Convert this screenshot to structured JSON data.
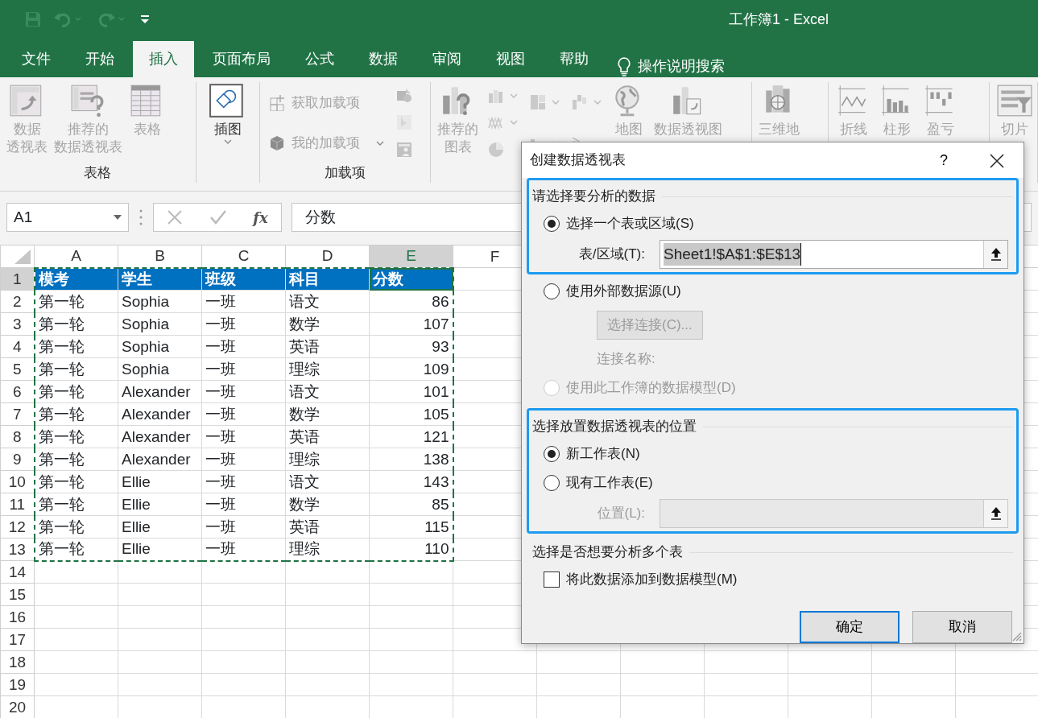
{
  "window": {
    "title": "工作簿1  -  Excel"
  },
  "tabs": [
    {
      "label": "文件",
      "selected": false
    },
    {
      "label": "开始",
      "selected": false
    },
    {
      "label": "插入",
      "selected": true
    },
    {
      "label": "页面布局",
      "selected": false
    },
    {
      "label": "公式",
      "selected": false
    },
    {
      "label": "数据",
      "selected": false
    },
    {
      "label": "审阅",
      "selected": false
    },
    {
      "label": "视图",
      "selected": false
    },
    {
      "label": "帮助",
      "selected": false
    }
  ],
  "tell_me": "操作说明搜索",
  "ribbon": {
    "groups": [
      {
        "label": "表格",
        "items": [
          {
            "kind": "large",
            "lines": [
              "数据",
              "透视表"
            ],
            "disabled": true
          },
          {
            "kind": "large",
            "lines": [
              "推荐的",
              "数据透视表"
            ],
            "disabled": true
          },
          {
            "kind": "large",
            "lines": [
              "表格"
            ],
            "disabled": true
          }
        ]
      },
      {
        "items": [
          {
            "kind": "large",
            "lines": [
              "插图"
            ],
            "disabled": false,
            "dropdown": true
          }
        ]
      },
      {
        "label": "加载项",
        "items": [
          {
            "kind": "stack",
            "items": [
              {
                "kind": "small",
                "lines": [
                  "获取加载项"
                ],
                "disabled": true
              },
              {
                "kind": "small",
                "lines": [
                  "我的加载项"
                ],
                "disabled": true,
                "dropdown": true
              }
            ]
          },
          {
            "kind": "stack",
            "items": [
              {
                "kind": "icon",
                "disabled": true
              },
              {
                "kind": "icon",
                "disabled": true
              },
              {
                "kind": "icon",
                "disabled": true
              }
            ]
          }
        ]
      },
      {
        "items": [
          {
            "kind": "large",
            "lines": [
              "推荐的",
              "图表"
            ],
            "disabled": true
          },
          {
            "kind": "stack",
            "items": [
              {
                "kind": "icon",
                "disabled": true,
                "dropdown": true
              },
              {
                "kind": "icon",
                "disabled": true,
                "dropdown": true
              },
              {
                "kind": "icon",
                "disabled": true
              }
            ]
          },
          {
            "kind": "stack",
            "items": [
              {
                "kind": "icon",
                "disabled": true,
                "dropdown": true
              },
              {
                "kind": "icon",
                "disabled": true,
                "dropdown": true
              }
            ]
          },
          {
            "kind": "stack",
            "items": [
              {
                "kind": "icon",
                "disabled": true,
                "dropdown": true
              },
              {
                "kind": "icon",
                "disabled": true,
                "dropdown": true
              }
            ]
          },
          {
            "kind": "large",
            "lines": [
              "地图"
            ],
            "disabled": true
          },
          {
            "kind": "large",
            "lines": [
              "数据透视图"
            ],
            "disabled": true
          }
        ]
      },
      {
        "items": [
          {
            "kind": "large",
            "lines": [
              "三维地"
            ],
            "disabled": true
          }
        ]
      },
      {
        "items": [
          {
            "kind": "large",
            "lines": [
              "折线"
            ],
            "disabled": true
          },
          {
            "kind": "large",
            "lines": [
              "柱形"
            ],
            "disabled": true
          },
          {
            "kind": "large",
            "lines": [
              "盈亏"
            ],
            "disabled": true
          }
        ]
      },
      {
        "items": [
          {
            "kind": "large",
            "lines": [
              "切片"
            ],
            "disabled": true
          }
        ]
      }
    ]
  },
  "name_box": "A1",
  "formula": {
    "fx": "fx",
    "value": "分数"
  },
  "sheet": {
    "columns": [
      {
        "label": "A",
        "selected": false
      },
      {
        "label": "B",
        "selected": false
      },
      {
        "label": "C",
        "selected": false
      },
      {
        "label": "D",
        "selected": false
      },
      {
        "label": "E",
        "selected": true,
        "numeric": true
      },
      {
        "label": "F",
        "selected": false
      }
    ],
    "rows": [
      {
        "number": "1",
        "selected": true,
        "kind": "heading",
        "cells": [
          "模考",
          "学生",
          "班级",
          "科目",
          "分数"
        ]
      },
      {
        "number": "2",
        "selected": false,
        "cells": [
          "第一轮",
          "Sophia",
          "一班",
          "语文",
          "86"
        ]
      },
      {
        "number": "3",
        "selected": false,
        "cells": [
          "第一轮",
          "Sophia",
          "一班",
          "数学",
          "107"
        ]
      },
      {
        "number": "4",
        "selected": false,
        "cells": [
          "第一轮",
          "Sophia",
          "一班",
          "英语",
          "93"
        ]
      },
      {
        "number": "5",
        "selected": false,
        "cells": [
          "第一轮",
          "Sophia",
          "一班",
          "理综",
          "109"
        ]
      },
      {
        "number": "6",
        "selected": false,
        "cells": [
          "第一轮",
          "Alexander",
          "一班",
          "语文",
          "101"
        ]
      },
      {
        "number": "7",
        "selected": false,
        "cells": [
          "第一轮",
          "Alexander",
          "一班",
          "数学",
          "105"
        ]
      },
      {
        "number": "8",
        "selected": false,
        "cells": [
          "第一轮",
          "Alexander",
          "一班",
          "英语",
          "121"
        ]
      },
      {
        "number": "9",
        "selected": false,
        "cells": [
          "第一轮",
          "Alexander",
          "一班",
          "理综",
          "138"
        ]
      },
      {
        "number": "10",
        "selected": false,
        "cells": [
          "第一轮",
          "Ellie",
          "一班",
          "语文",
          "143"
        ]
      },
      {
        "number": "11",
        "selected": false,
        "cells": [
          "第一轮",
          "Ellie",
          "一班",
          "数学",
          "85"
        ]
      },
      {
        "number": "12",
        "selected": false,
        "cells": [
          "第一轮",
          "Ellie",
          "一班",
          "英语",
          "115"
        ]
      },
      {
        "number": "13",
        "selected": false,
        "cells": [
          "第一轮",
          "Ellie",
          "一班",
          "理综",
          "110"
        ]
      },
      {
        "number": "14",
        "selected": false,
        "cells": []
      },
      {
        "number": "15",
        "selected": false,
        "cells": []
      },
      {
        "number": "16",
        "selected": false,
        "cells": []
      },
      {
        "number": "17",
        "selected": false,
        "cells": []
      },
      {
        "number": "18",
        "selected": false,
        "cells": []
      },
      {
        "number": "19",
        "selected": false,
        "cells": []
      },
      {
        "number": "20",
        "selected": false,
        "cells": []
      }
    ]
  },
  "dialog": {
    "title": "创建数据透视表",
    "help": "?",
    "sections": [
      {
        "heading": "请选择要分析的数据",
        "highlighted": true,
        "rows": [
          {
            "kind": "radio",
            "label": "选择一个表或区域(S)",
            "selected": true,
            "disabled": false
          },
          {
            "kind": "field",
            "label": "表/区域(T):",
            "value": "Sheet1!$A$1:$E$13",
            "disabled": false
          }
        ]
      },
      {
        "highlighted": false,
        "rows": [
          {
            "kind": "radio",
            "label": "使用外部数据源(U)",
            "selected": false,
            "disabled": false
          },
          {
            "kind": "button",
            "label": "选择连接(C)...",
            "disabled": true
          },
          {
            "kind": "text",
            "label": "连接名称:",
            "disabled": true
          },
          {
            "kind": "radio",
            "label": "使用此工作簿的数据模型(D)",
            "selected": false,
            "disabled": true
          }
        ]
      },
      {
        "heading": "选择放置数据透视表的位置",
        "highlighted": true,
        "rows": [
          {
            "kind": "radio",
            "label": "新工作表(N)",
            "selected": true,
            "disabled": false
          },
          {
            "kind": "radio",
            "label": "现有工作表(E)",
            "selected": false,
            "disabled": false
          },
          {
            "kind": "field",
            "label": "位置(L):",
            "disabled": true
          }
        ]
      },
      {
        "heading": "选择是否想要分析多个表",
        "highlighted": false,
        "rows": [
          {
            "kind": "checkbox",
            "label": "将此数据添加到数据模型(M)",
            "checked": false,
            "disabled": false
          }
        ]
      }
    ],
    "buttons": [
      {
        "label": "确定",
        "default": true
      },
      {
        "label": "取消",
        "default": false
      }
    ]
  }
}
